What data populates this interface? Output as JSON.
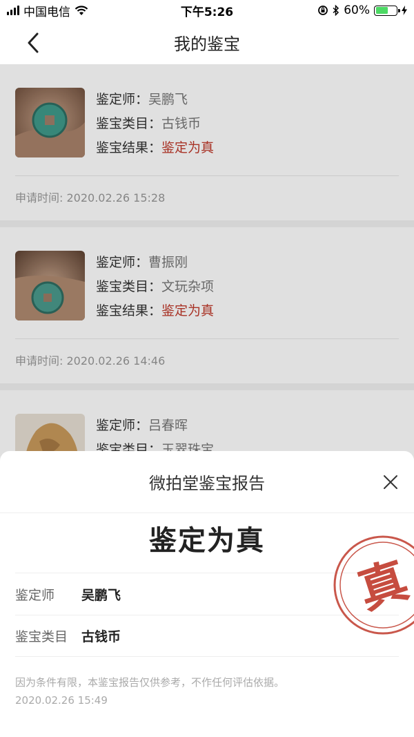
{
  "status_bar": {
    "carrier": "中国电信",
    "time": "下午5:26",
    "battery": "60%",
    "battery_level": 0.6
  },
  "nav": {
    "title": "我的鉴宝",
    "back_icon": "chevron-left-icon"
  },
  "labels": {
    "appraiser": "鉴定师：",
    "category": "鉴宝类目：",
    "result": "鉴宝结果：",
    "apply_time_prefix": "申请时间: "
  },
  "records": [
    {
      "appraiser": "吴鹏飞",
      "category": "古钱币",
      "result": "鉴定为真",
      "apply_time": "申请时间: 2020.02.26 15:28"
    },
    {
      "appraiser": "曹振刚",
      "category": "文玩杂项",
      "result": "鉴定为真",
      "apply_time": "申请时间: 2020.02.26 14:46"
    },
    {
      "appraiser": "吕春晖",
      "category": "玉翠珠宝",
      "result": "",
      "apply_time": ""
    }
  ],
  "report": {
    "title": "微拍堂鉴宝报告",
    "result": "鉴定为真",
    "appraiser_label": "鉴定师",
    "appraiser": "吴鹏飞",
    "category_label": "鉴宝类目",
    "category": "古钱币",
    "disclaimer": "因为条件有限，本鉴宝报告仅供参考，不作任何评估依据。",
    "time": "2020.02.26 15:49",
    "stamp_text": "真"
  },
  "colors": {
    "accent_red": "#c0392b",
    "battery_green": "#4cd964"
  }
}
